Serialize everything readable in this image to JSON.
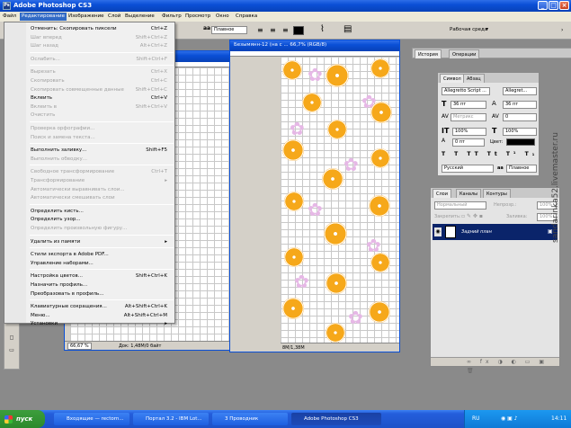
{
  "titlebar": {
    "title": "Adobe Photoshop CS3"
  },
  "menubar": {
    "items": [
      "Файл",
      "Редактирование",
      "Изображение",
      "Слой",
      "Выделение",
      "Фильтр",
      "Просмотр",
      "Окно",
      "Справка"
    ]
  },
  "optionsbar": {
    "blend_mode": "Плавное",
    "workspace_label": "Рабочая среда"
  },
  "edit_menu": [
    {
      "label": "Отменить: Скопировать пиксели",
      "shortcut": "Ctrl+Z",
      "disabled": false
    },
    {
      "label": "Шаг вперед",
      "shortcut": "Shift+Ctrl+Z",
      "disabled": true
    },
    {
      "label": "Шаг назад",
      "shortcut": "Alt+Ctrl+Z",
      "disabled": true
    },
    {
      "sep": true
    },
    {
      "label": "Ослабить...",
      "shortcut": "Shift+Ctrl+F",
      "disabled": true
    },
    {
      "sep": true
    },
    {
      "label": "Вырезать",
      "shortcut": "Ctrl+X",
      "disabled": true
    },
    {
      "label": "Скопировать",
      "shortcut": "Ctrl+C",
      "disabled": true
    },
    {
      "label": "Скопировать совмещенные данные",
      "shortcut": "Shift+Ctrl+C",
      "disabled": true
    },
    {
      "label": "Вклеить",
      "shortcut": "Ctrl+V",
      "disabled": false
    },
    {
      "label": "Вклеить в",
      "shortcut": "Shift+Ctrl+V",
      "disabled": true
    },
    {
      "label": "Очистить",
      "shortcut": "",
      "disabled": true
    },
    {
      "sep": true
    },
    {
      "label": "Проверка орфографии...",
      "shortcut": "",
      "disabled": true
    },
    {
      "label": "Поиск и замена текста...",
      "shortcut": "",
      "disabled": true
    },
    {
      "sep": true
    },
    {
      "label": "Выполнить заливку...",
      "shortcut": "Shift+F5",
      "disabled": false
    },
    {
      "label": "Выполнить обводку...",
      "shortcut": "",
      "disabled": true
    },
    {
      "sep": true
    },
    {
      "label": "Свободное трансформирование",
      "shortcut": "Ctrl+T",
      "disabled": true
    },
    {
      "label": "Трансформирование",
      "shortcut": "",
      "disabled": true,
      "submenu": true
    },
    {
      "label": "Автоматически выравнивать слои...",
      "shortcut": "",
      "disabled": true
    },
    {
      "label": "Автоматически смешивать слои",
      "shortcut": "",
      "disabled": true
    },
    {
      "sep": true
    },
    {
      "label": "Определить кисть...",
      "shortcut": "",
      "disabled": false
    },
    {
      "label": "Определить узор...",
      "shortcut": "",
      "disabled": false
    },
    {
      "label": "Определить произвольную фигуру...",
      "shortcut": "",
      "disabled": true
    },
    {
      "sep": true
    },
    {
      "label": "Удалить из памяти",
      "shortcut": "",
      "disabled": false,
      "submenu": true
    },
    {
      "sep": true
    },
    {
      "label": "Стили экспорта в Adobe PDF...",
      "shortcut": "",
      "disabled": false
    },
    {
      "label": "Управление наборами...",
      "shortcut": "",
      "disabled": false
    },
    {
      "sep": true
    },
    {
      "label": "Настройка цветов...",
      "shortcut": "Shift+Ctrl+K",
      "disabled": false
    },
    {
      "label": "Назначить профиль...",
      "shortcut": "",
      "disabled": false
    },
    {
      "label": "Преобразовать в профиль...",
      "shortcut": "",
      "disabled": false
    },
    {
      "sep": true
    },
    {
      "label": "Клавиатурные сокращения...",
      "shortcut": "Alt+Shift+Ctrl+K",
      "disabled": false
    },
    {
      "label": "Меню...",
      "shortcut": "Alt+Shift+Ctrl+M",
      "disabled": false
    },
    {
      "label": "Установки",
      "shortcut": "",
      "disabled": false,
      "submenu": true
    }
  ],
  "doc1": {
    "zoom": "66,67 %",
    "doc_info": "Док: 1,48М/0 байт"
  },
  "doc2": {
    "title": "Безымянн-12 (на с ... 66,7% (RGB/8)",
    "status": "8М/1,38М"
  },
  "history_panel": {
    "tabs": [
      "История",
      "Операции"
    ]
  },
  "character_panel": {
    "tabs": [
      "Символ",
      "Абзац"
    ],
    "font": "Allegretto Script ...",
    "style": "Allegret...",
    "size1": "36 пт",
    "size2": "36 пт",
    "metric": "Метрикс",
    "zero": "0",
    "scale1": "100%",
    "scale2": "100%",
    "baseline": "0 пт",
    "color_label": "Цвет:",
    "language": "Русский",
    "aa": "aa",
    "aa_mode": "Плавное",
    "color": "#000000"
  },
  "layers_panel": {
    "tabs": [
      "Слои",
      "Каналы",
      "Контуры"
    ],
    "blend": "Нормальный",
    "opacity_label": "Непрозр.:",
    "opacity": "100%",
    "lock_label": "Закрепить:",
    "fill_label": "Заливка:",
    "fill": "100%",
    "layer_name": "Задний план"
  },
  "taskbar": {
    "start": "пуск",
    "tasks": [
      "Входящие — rectorn...",
      "Портал 3.2 - IBM Lot...",
      "3 Проводник",
      "Adobe Photoshop CS3"
    ],
    "lang": "RU",
    "time": "14:11"
  },
  "watermark": "sandarinka52.livemaster.ru",
  "colors": {
    "xp_blue": "#0a4fd6",
    "menu_highlight": "#316ac5",
    "orange": "#f6a81a",
    "selection": "#0a246a"
  }
}
